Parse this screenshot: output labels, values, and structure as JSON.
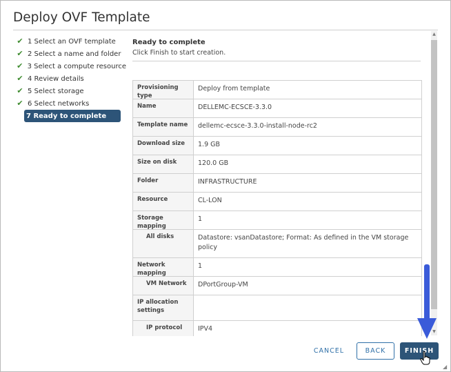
{
  "dialog": {
    "title": "Deploy OVF Template"
  },
  "steps": [
    {
      "label": "1 Select an OVF template",
      "done": true
    },
    {
      "label": "2 Select a name and folder",
      "done": true
    },
    {
      "label": "3 Select a compute resource",
      "done": true
    },
    {
      "label": "4 Review details",
      "done": true
    },
    {
      "label": "5 Select storage",
      "done": true
    },
    {
      "label": "6 Select networks",
      "done": true
    },
    {
      "label": "7 Ready to complete",
      "done": false,
      "active": true
    }
  ],
  "content": {
    "title": "Ready to complete",
    "subtitle": "Click Finish to start creation."
  },
  "details": [
    {
      "key": "Provisioning type",
      "value": "Deploy from template"
    },
    {
      "key": "Name",
      "value": "DELLEMC-ECSCE-3.3.0"
    },
    {
      "key": "Template name",
      "value": "dellemc-ecsce-3.3.0-install-node-rc2"
    },
    {
      "key": "Download size",
      "value": "1.9 GB"
    },
    {
      "key": "Size on disk",
      "value": "120.0 GB"
    },
    {
      "key": "Folder",
      "value": "INFRASTRUCTURE"
    },
    {
      "key": "Resource",
      "value": "CL-LON"
    },
    {
      "key": "Storage mapping",
      "value": "1"
    },
    {
      "key": "All disks",
      "value": "Datastore: vsanDatastore; Format: As defined in the VM storage policy",
      "indent": true
    },
    {
      "key": "Network mapping",
      "value": "1"
    },
    {
      "key": "VM Network",
      "value": "DPortGroup-VM",
      "indent": true
    },
    {
      "key": "IP allocation settings",
      "value": ""
    },
    {
      "key": "IP protocol",
      "value": "IPV4",
      "indent": true
    },
    {
      "key": "",
      "value": ""
    }
  ],
  "buttons": {
    "cancel": "CANCEL",
    "back": "BACK",
    "finish": "FINISH"
  },
  "colors": {
    "accent": "#2d5478",
    "link": "#2e6fa7",
    "check": "#3e8b2f",
    "annotation_arrow": "#3a5bd9"
  },
  "icons": {
    "step_done": "checkmark-icon",
    "annotation": "down-arrow-icon",
    "pointer": "hand-cursor-icon"
  }
}
